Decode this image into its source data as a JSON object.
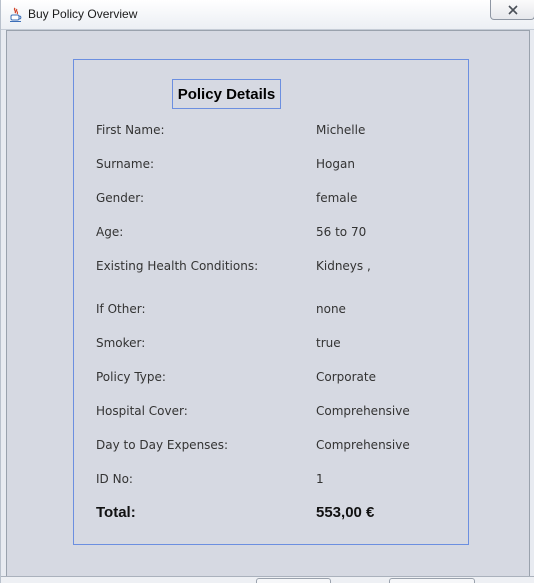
{
  "window": {
    "title": "Buy Policy Overview",
    "icon": "java-cup-icon",
    "close_icon": "close-icon"
  },
  "panel": {
    "title": "Policy Details",
    "rows": [
      {
        "label": "First Name:",
        "value": "Michelle"
      },
      {
        "label": "Surname:",
        "value": "Hogan"
      },
      {
        "label": "Gender:",
        "value": "female"
      },
      {
        "label": "Age:",
        "value": "56 to 70"
      },
      {
        "label": "Existing Health Conditions:",
        "value": "Kidneys ,"
      },
      {
        "label": "If Other:",
        "value": "none"
      },
      {
        "label": "Smoker:",
        "value": "true"
      },
      {
        "label": "Policy Type:",
        "value": "Corporate"
      },
      {
        "label": "Hospital Cover:",
        "value": "Comprehensive"
      },
      {
        "label": "Day to Day Expenses:",
        "value": "Comprehensive"
      },
      {
        "label": "ID No:",
        "value": "1"
      }
    ],
    "total": {
      "label": "Total:",
      "value": "553,00 €"
    }
  },
  "colors": {
    "panel_border": "#6c8fe0",
    "client_bg": "#d6d9e2"
  }
}
